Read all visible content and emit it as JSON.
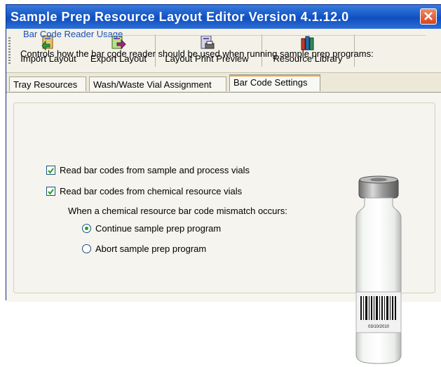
{
  "window": {
    "title": "Sample Prep Resource Layout Editor Version 4.1.12.0"
  },
  "toolbar": {
    "import_label": "Import Layout",
    "export_label": "Export Layout",
    "print_label": "Layout Print Preview",
    "library_label": "Resource Library"
  },
  "tabs": [
    {
      "label": "Tray Resources"
    },
    {
      "label": "Wash/Waste Vial Assignment"
    },
    {
      "label": "Bar Code Settings"
    }
  ],
  "group": {
    "title": "Bar Code Reader Usage",
    "description": "Controls how the bar code reader should be used when running sample prep programs:",
    "checkbox_sample": {
      "label": "Read bar codes from sample and process vials",
      "checked": true
    },
    "checkbox_chemical": {
      "label": "Read bar codes from chemical resource vials",
      "checked": true
    },
    "mismatch_prompt": "When a chemical resource bar code mismatch occurs:",
    "radio_continue": {
      "label": "Continue sample prep program",
      "selected": true
    },
    "radio_abort": {
      "label": "Abort sample prep program",
      "selected": false
    }
  },
  "vial": {
    "barcode_text": "03/10/2010"
  },
  "colors": {
    "title_bar": "#1658c8",
    "group_title": "#1a4fb8",
    "radio_dot": "#21a121"
  }
}
